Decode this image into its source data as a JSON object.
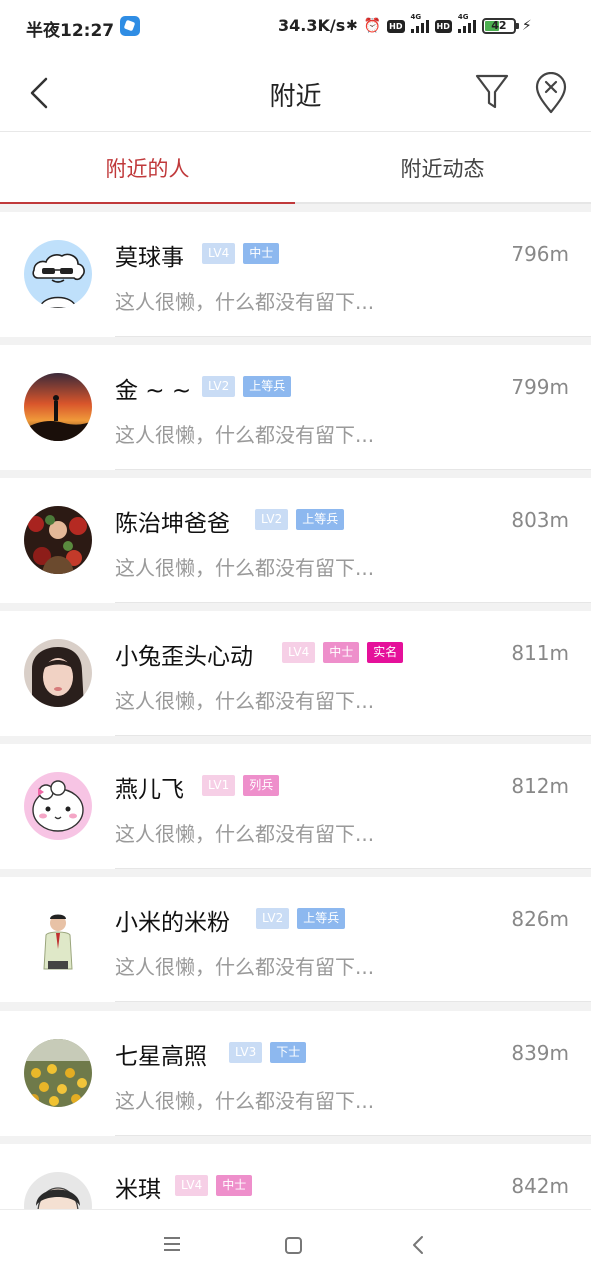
{
  "status_bar": {
    "time": "半夜12:27",
    "network_speed": "34.3K/s",
    "battery": "42",
    "icons": [
      "app-icon",
      "bluetooth-icon",
      "alarm-icon",
      "hd-icon",
      "signal-4g-icon",
      "charging-icon"
    ]
  },
  "header": {
    "title": "附近",
    "icons": [
      "back-icon",
      "filter-icon",
      "clear-location-icon"
    ]
  },
  "tabs": [
    {
      "label": "附近的人",
      "active": true
    },
    {
      "label": "附近动态",
      "active": false
    }
  ],
  "people": [
    {
      "name": "莫球事",
      "level": "LV4",
      "rank": "中士",
      "distance": "796m",
      "signature": "这人很懒，什么都没有留下...",
      "level_color": "#c9dcf5",
      "rank_color": "#8db8ef"
    },
    {
      "name": "金 ~ ~",
      "level": "LV2",
      "rank": "上等兵",
      "distance": "799m",
      "signature": "这人很懒，什么都没有留下...",
      "level_color": "#c9dcf5",
      "rank_color": "#8db8ef"
    },
    {
      "name": "陈治坤爸爸",
      "level": "LV2",
      "rank": "上等兵",
      "distance": "803m",
      "signature": "这人很懒，什么都没有留下...",
      "level_color": "#c9dcf5",
      "rank_color": "#8db8ef"
    },
    {
      "name": "小兔歪头心动",
      "level": "LV4",
      "rank": "中士",
      "verified": "实名",
      "distance": "811m",
      "signature": "这人很懒，什么都没有留下...",
      "level_color": "#f6cfe6",
      "rank_color": "#ee8fcb"
    },
    {
      "name": "燕儿飞",
      "level": "LV1",
      "rank": "列兵",
      "distance": "812m",
      "signature": "这人很懒，什么都没有留下...",
      "level_color": "#f6cfe6",
      "rank_color": "#ee8fcb"
    },
    {
      "name": "小米的米粉",
      "level": "LV2",
      "rank": "上等兵",
      "distance": "826m",
      "signature": "这人很懒，什么都没有留下...",
      "level_color": "#c9dcf5",
      "rank_color": "#8db8ef"
    },
    {
      "name": "七星高照",
      "level": "LV3",
      "rank": "下士",
      "distance": "839m",
      "signature": "这人很懒，什么都没有留下...",
      "level_color": "#c9dcf5",
      "rank_color": "#8db8ef"
    },
    {
      "name": "米琪",
      "level": "LV4",
      "rank": "中士",
      "distance": "842m",
      "signature": "",
      "level_color": "#f6cfe6",
      "rank_color": "#ee8fcb"
    }
  ],
  "nav_bar": {
    "icons": [
      "menu-icon",
      "home-icon",
      "back-icon"
    ]
  },
  "colors": {
    "accent": "#c0393b",
    "verified": "#e5109a"
  }
}
